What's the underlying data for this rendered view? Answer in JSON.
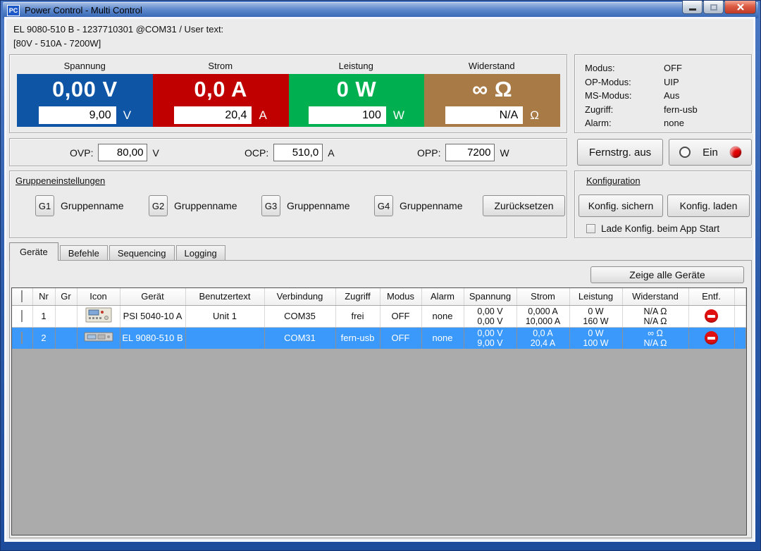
{
  "window": {
    "icon_text": "PC",
    "title": "Power Control - Multi Control"
  },
  "header": {
    "line1": "EL 9080-510 B - 1237710301 @COM31 / User text:",
    "line2": "[80V - 510A - 7200W]"
  },
  "meters": [
    {
      "label": "Spannung",
      "value": "0,00 V",
      "set_value": "9,00",
      "unit": "V",
      "color": "#0E56A5"
    },
    {
      "label": "Strom",
      "value": "0,0 A",
      "set_value": "20,4",
      "unit": "A",
      "color": "#C00000"
    },
    {
      "label": "Leistung",
      "value": "0 W",
      "set_value": "100",
      "unit": "W",
      "color": "#00AF50"
    },
    {
      "label": "Widerstand",
      "value": "∞ Ω",
      "set_value": "N/A",
      "unit": "Ω",
      "color": "#A87A45"
    }
  ],
  "status": [
    {
      "label": "Modus:",
      "value": "OFF"
    },
    {
      "label": "OP-Modus:",
      "value": "UIP"
    },
    {
      "label": "MS-Modus:",
      "value": "Aus"
    },
    {
      "label": "Zugriff:",
      "value": "fern-usb"
    },
    {
      "label": "Alarm:",
      "value": "none"
    }
  ],
  "protection": [
    {
      "label": "OVP:",
      "value": "80,00",
      "unit": "V"
    },
    {
      "label": "OCP:",
      "value": "510,0",
      "unit": "A"
    },
    {
      "label": "OPP:",
      "value": "7200",
      "unit": "W"
    }
  ],
  "controls": {
    "remote_label": "Fernstrg. aus",
    "on_label": "Ein",
    "led_color": "#E00000"
  },
  "groups": {
    "title": "Gruppeneinstellungen",
    "items": [
      {
        "id": "G1",
        "name": "Gruppenname"
      },
      {
        "id": "G2",
        "name": "Gruppenname"
      },
      {
        "id": "G3",
        "name": "Gruppenname"
      },
      {
        "id": "G4",
        "name": "Gruppenname"
      }
    ],
    "reset_label": "Zurücksetzen"
  },
  "config": {
    "title": "Konfiguration",
    "save_label": "Konfig. sichern",
    "load_label": "Konfig. laden",
    "autoload_label": "Lade Konfig. beim App Start",
    "autoload_checked": false
  },
  "tabs": [
    {
      "label": "Geräte"
    },
    {
      "label": "Befehle"
    },
    {
      "label": "Sequencing"
    },
    {
      "label": "Logging"
    }
  ],
  "device_table": {
    "show_all_label": "Zeige alle Geräte",
    "columns": [
      "",
      "Nr",
      "Gr",
      "Icon",
      "Gerät",
      "Benutzertext",
      "Verbindung",
      "Zugriff",
      "Modus",
      "Alarm",
      "Spannung",
      "Strom",
      "Leistung",
      "Widerstand",
      "Entf."
    ],
    "rows": [
      {
        "nr": "1",
        "gr": "",
        "geraet": "PSI 5040-10 A",
        "benutzertext": "Unit 1",
        "verbindung": "COM35",
        "zugriff": "frei",
        "modus": "OFF",
        "alarm": "none",
        "spannung": [
          "0,00 V",
          "0,00 V"
        ],
        "strom": [
          "0,000 A",
          "10,000 A"
        ],
        "leistung": [
          "0 W",
          "160 W"
        ],
        "widerstand": [
          "N/A Ω",
          "N/A Ω"
        ]
      },
      {
        "nr": "2",
        "gr": "",
        "geraet": "EL 9080-510 B",
        "benutzertext": "",
        "verbindung": "COM31",
        "zugriff": "fern-usb",
        "modus": "OFF",
        "alarm": "none",
        "spannung": [
          "0,00 V",
          "9,00 V"
        ],
        "strom": [
          "0,0 A",
          "20,4 A"
        ],
        "leistung": [
          "0 W",
          "100 W"
        ],
        "widerstand": [
          "∞ Ω",
          "N/A Ω"
        ]
      }
    ]
  },
  "colors": {
    "selection_row": "#3B99FC",
    "remove_icon": "#E01010",
    "table_empty_bg": "#ABABAB"
  }
}
